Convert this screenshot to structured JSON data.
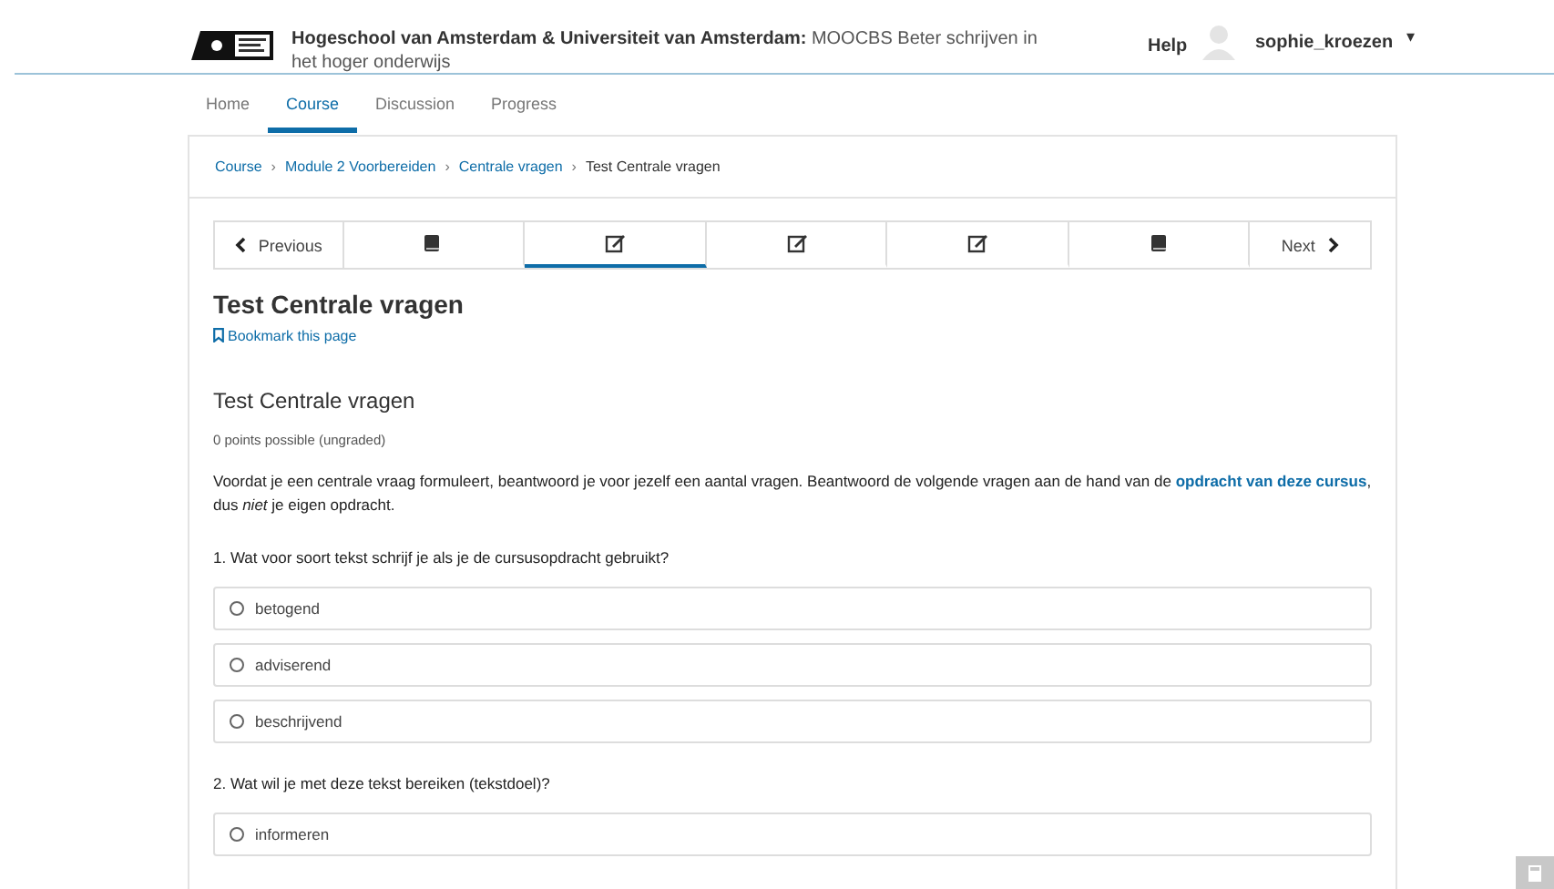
{
  "header": {
    "title": "**Hogeschool van Amsterdam & Universiteit van Amsterdam:** MOOCBS Beter schrijven in het hoger onderwijs",
    "help": "Help",
    "username": "sophie_kroezen",
    "menu_caret": "▾"
  },
  "nav_tabs": [
    {
      "label": "Home",
      "selected": false
    },
    {
      "label": "Course",
      "selected": true
    },
    {
      "label": "Discussion",
      "selected": false
    },
    {
      "label": "Progress",
      "selected": false
    }
  ],
  "breadcrumb_separator": "›",
  "breadcrumb": [
    {
      "label": "Course",
      "link": true
    },
    {
      "label": "Module 2 Voorbereiden",
      "link": true
    },
    {
      "label": "Centrale vragen",
      "link": true
    },
    {
      "label": "Test Centrale vragen",
      "link": false
    }
  ],
  "sequence": {
    "previous": "Previous",
    "next": "Next",
    "units": [
      {
        "kind": "book",
        "selected": false
      },
      {
        "kind": "edit",
        "selected": true
      },
      {
        "kind": "edit",
        "selected": false
      },
      {
        "kind": "edit",
        "selected": false
      },
      {
        "kind": "book",
        "selected": false
      }
    ]
  },
  "page_title": "Test Centrale vragen",
  "bookmark": "Bookmark this page",
  "problem": {
    "title": "Test Centrale vragen",
    "points": "0 points possible (ungraded)",
    "intro": "Voordat je een centrale vraag formuleert, beantwoord je voor jezelf een aantal vragen. Beantwoord de volgende vragen aan de hand van de **opdracht van deze cursus**, dus *niet* je eigen opdracht.",
    "questions": [
      {
        "text": "1. Wat voor soort tekst schrijf je als je de cursusopdracht gebruikt?",
        "options": [
          {
            "label": "betogend",
            "selected": false
          },
          {
            "label": "adviserend",
            "selected": false
          },
          {
            "label": "beschrijvend",
            "selected": false
          }
        ]
      },
      {
        "text": "2. Wat wil je met deze tekst bereiken (tekstdoel)?",
        "options": [
          {
            "label": "informeren",
            "selected": false
          }
        ]
      }
    ]
  }
}
